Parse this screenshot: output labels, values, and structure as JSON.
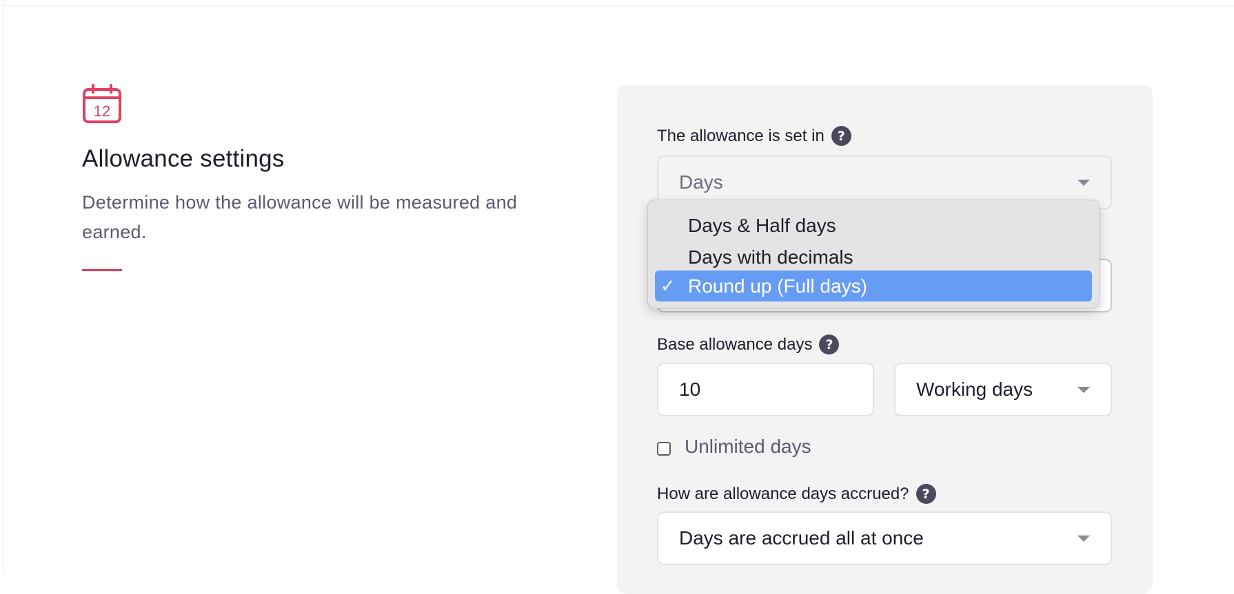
{
  "intro": {
    "icon": "calendar-icon",
    "calendar_day": "12",
    "title": "Allowance settings",
    "description": "Determine how the allowance will be measured and earned.",
    "accent_color": "#e0405e"
  },
  "allowance_unit": {
    "label": "The allowance is set in",
    "value": "Days",
    "help_icon": "?"
  },
  "rounding_menu": {
    "options": [
      {
        "label": "Days & Half days",
        "selected": false
      },
      {
        "label": "Days with decimals",
        "selected": false
      },
      {
        "label": "Round up (Full days)",
        "selected": true
      }
    ],
    "check_mark": "✓",
    "highlight_color": "#679cf5"
  },
  "base_allowance": {
    "label": "Base allowance days",
    "help_icon": "?",
    "value": "10",
    "day_type": "Working days"
  },
  "unlimited": {
    "label": "Unlimited days",
    "checked": false
  },
  "accrual": {
    "label": "How are allowance days accrued?",
    "help_icon": "?",
    "value": "Days are accrued all at once"
  }
}
